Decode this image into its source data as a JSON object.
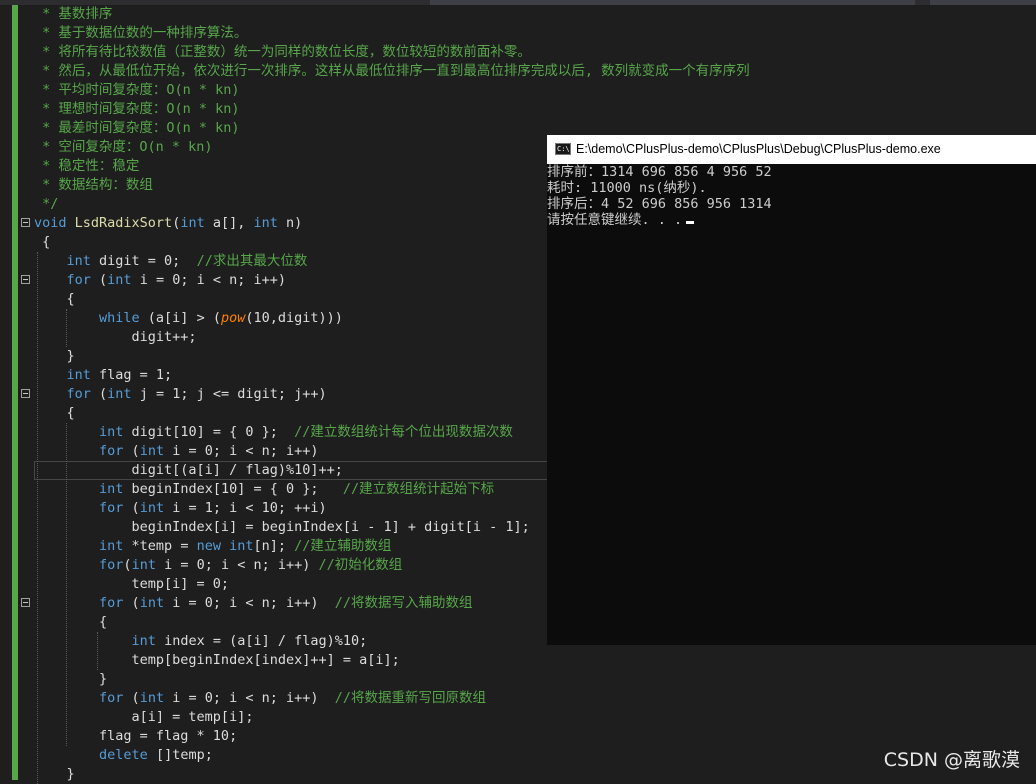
{
  "editor": {
    "lines": [
      {
        "fold": false,
        "tokens": [
          {
            "c": "cm",
            "t": " * 基数排序"
          }
        ]
      },
      {
        "fold": false,
        "tokens": [
          {
            "c": "cm",
            "t": " * 基于数据位数的一种排序算法。"
          }
        ]
      },
      {
        "fold": false,
        "tokens": [
          {
            "c": "cm",
            "t": " * 将所有待比较数值（正整数）统一为同样的数位长度，数位较短的数前面补零。"
          }
        ]
      },
      {
        "fold": false,
        "tokens": [
          {
            "c": "cm",
            "t": " * 然后，从最低位开始，依次进行一次排序。这样从最低位排序一直到最高位排序完成以后, 数列就变成一个有序序列"
          }
        ]
      },
      {
        "fold": false,
        "tokens": [
          {
            "c": "cm",
            "t": " * 平均时间复杂度：O(n * kn)"
          }
        ]
      },
      {
        "fold": false,
        "tokens": [
          {
            "c": "cm",
            "t": " * 理想时间复杂度：O(n * kn)"
          }
        ]
      },
      {
        "fold": false,
        "tokens": [
          {
            "c": "cm",
            "t": " * 最差时间复杂度：O(n * kn)"
          }
        ]
      },
      {
        "fold": false,
        "tokens": [
          {
            "c": "cm",
            "t": " * 空间复杂度：O(n * kn)"
          }
        ]
      },
      {
        "fold": false,
        "tokens": [
          {
            "c": "cm",
            "t": " * 稳定性：稳定"
          }
        ]
      },
      {
        "fold": false,
        "tokens": [
          {
            "c": "cm",
            "t": " * 数据结构：数组"
          }
        ]
      },
      {
        "fold": false,
        "tokens": [
          {
            "c": "cm",
            "t": " */"
          }
        ]
      },
      {
        "fold": true,
        "tokens": [
          {
            "c": "kw",
            "t": "void"
          },
          {
            "c": "pl",
            "t": " "
          },
          {
            "c": "fn",
            "t": "LsdRadixSort"
          },
          {
            "c": "pl",
            "t": "("
          },
          {
            "c": "kw",
            "t": "int"
          },
          {
            "c": "pl",
            "t": " a[], "
          },
          {
            "c": "kw",
            "t": "int"
          },
          {
            "c": "pl",
            "t": " n)"
          }
        ]
      },
      {
        "fold": false,
        "tokens": [
          {
            "c": "pl",
            "t": " {"
          }
        ]
      },
      {
        "fold": false,
        "tokens": [
          {
            "c": "pl",
            "t": "    "
          },
          {
            "c": "kw",
            "t": "int"
          },
          {
            "c": "pl",
            "t": " digit = 0;  "
          },
          {
            "c": "cm",
            "t": "//求出其最大位数"
          }
        ]
      },
      {
        "fold": true,
        "tokens": [
          {
            "c": "pl",
            "t": "    "
          },
          {
            "c": "kw",
            "t": "for"
          },
          {
            "c": "pl",
            "t": " ("
          },
          {
            "c": "kw",
            "t": "int"
          },
          {
            "c": "pl",
            "t": " i = 0; i < n; i++)"
          }
        ]
      },
      {
        "fold": false,
        "tokens": [
          {
            "c": "pl",
            "t": "    {"
          }
        ]
      },
      {
        "fold": false,
        "tokens": [
          {
            "c": "pl",
            "t": "        "
          },
          {
            "c": "kw",
            "t": "while"
          },
          {
            "c": "pl",
            "t": " (a[i] > ("
          },
          {
            "c": "fn2",
            "t": "pow"
          },
          {
            "c": "pl",
            "t": "(10,digit)))"
          }
        ]
      },
      {
        "fold": false,
        "tokens": [
          {
            "c": "pl",
            "t": "            digit++;"
          }
        ]
      },
      {
        "fold": false,
        "tokens": [
          {
            "c": "pl",
            "t": "    }"
          }
        ]
      },
      {
        "fold": false,
        "tokens": [
          {
            "c": "pl",
            "t": "    "
          },
          {
            "c": "kw",
            "t": "int"
          },
          {
            "c": "pl",
            "t": " flag = 1;"
          }
        ]
      },
      {
        "fold": true,
        "tokens": [
          {
            "c": "pl",
            "t": "    "
          },
          {
            "c": "kw",
            "t": "for"
          },
          {
            "c": "pl",
            "t": " ("
          },
          {
            "c": "kw",
            "t": "int"
          },
          {
            "c": "pl",
            "t": " j = 1; j <= digit; j++)"
          }
        ]
      },
      {
        "fold": false,
        "tokens": [
          {
            "c": "pl",
            "t": "    {"
          }
        ]
      },
      {
        "fold": false,
        "tokens": [
          {
            "c": "pl",
            "t": "        "
          },
          {
            "c": "kw",
            "t": "int"
          },
          {
            "c": "pl",
            "t": " digit[10] = { 0 };  "
          },
          {
            "c": "cm",
            "t": "//建立数组统计每个位出现数据次数"
          }
        ]
      },
      {
        "fold": false,
        "tokens": [
          {
            "c": "pl",
            "t": "        "
          },
          {
            "c": "kw",
            "t": "for"
          },
          {
            "c": "pl",
            "t": " ("
          },
          {
            "c": "kw",
            "t": "int"
          },
          {
            "c": "pl",
            "t": " i = 0; i < n; i++)"
          }
        ]
      },
      {
        "fold": false,
        "tokens": [
          {
            "c": "pl",
            "t": "            digit[(a[i] / flag)%10]++;"
          }
        ]
      },
      {
        "fold": false,
        "tokens": [
          {
            "c": "pl",
            "t": "        "
          },
          {
            "c": "kw",
            "t": "int"
          },
          {
            "c": "pl",
            "t": " beginIndex[10] = { 0 };   "
          },
          {
            "c": "cm",
            "t": "//建立数组统计起始下标"
          }
        ]
      },
      {
        "fold": false,
        "tokens": [
          {
            "c": "pl",
            "t": "        "
          },
          {
            "c": "kw",
            "t": "for"
          },
          {
            "c": "pl",
            "t": " ("
          },
          {
            "c": "kw",
            "t": "int"
          },
          {
            "c": "pl",
            "t": " i = 1; i < 10; ++i)"
          }
        ]
      },
      {
        "fold": false,
        "tokens": [
          {
            "c": "pl",
            "t": "            beginIndex[i] = beginIndex[i - 1] + digit[i - 1];"
          }
        ]
      },
      {
        "fold": false,
        "tokens": [
          {
            "c": "pl",
            "t": "        "
          },
          {
            "c": "kw",
            "t": "int"
          },
          {
            "c": "pl",
            "t": " *temp = "
          },
          {
            "c": "kw",
            "t": "new"
          },
          {
            "c": "pl",
            "t": " "
          },
          {
            "c": "kw",
            "t": "int"
          },
          {
            "c": "pl",
            "t": "[n]; "
          },
          {
            "c": "cm",
            "t": "//建立辅助数组"
          }
        ]
      },
      {
        "fold": false,
        "tokens": [
          {
            "c": "pl",
            "t": "        "
          },
          {
            "c": "kw",
            "t": "for"
          },
          {
            "c": "pl",
            "t": "("
          },
          {
            "c": "kw",
            "t": "int"
          },
          {
            "c": "pl",
            "t": " i = 0; i < n; i++) "
          },
          {
            "c": "cm",
            "t": "//初始化数组"
          }
        ]
      },
      {
        "fold": false,
        "tokens": [
          {
            "c": "pl",
            "t": "            temp[i] = 0;"
          }
        ]
      },
      {
        "fold": true,
        "tokens": [
          {
            "c": "pl",
            "t": "        "
          },
          {
            "c": "kw",
            "t": "for"
          },
          {
            "c": "pl",
            "t": " ("
          },
          {
            "c": "kw",
            "t": "int"
          },
          {
            "c": "pl",
            "t": " i = 0; i < n; i++)  "
          },
          {
            "c": "cm",
            "t": "//将数据写入辅助数组"
          }
        ]
      },
      {
        "fold": false,
        "tokens": [
          {
            "c": "pl",
            "t": "        {"
          }
        ]
      },
      {
        "fold": false,
        "tokens": [
          {
            "c": "pl",
            "t": "            "
          },
          {
            "c": "kw",
            "t": "int"
          },
          {
            "c": "pl",
            "t": " index = (a[i] / flag)%10;"
          }
        ]
      },
      {
        "fold": false,
        "tokens": [
          {
            "c": "pl",
            "t": "            temp[beginIndex[index]++] = a[i];"
          }
        ]
      },
      {
        "fold": false,
        "tokens": [
          {
            "c": "pl",
            "t": "        }"
          }
        ]
      },
      {
        "fold": false,
        "tokens": [
          {
            "c": "pl",
            "t": "        "
          },
          {
            "c": "kw",
            "t": "for"
          },
          {
            "c": "pl",
            "t": " ("
          },
          {
            "c": "kw",
            "t": "int"
          },
          {
            "c": "pl",
            "t": " i = 0; i < n; i++)  "
          },
          {
            "c": "cm",
            "t": "//将数据重新写回原数组"
          }
        ]
      },
      {
        "fold": false,
        "tokens": [
          {
            "c": "pl",
            "t": "            a[i] = temp[i];"
          }
        ]
      },
      {
        "fold": false,
        "tokens": [
          {
            "c": "pl",
            "t": "        flag = flag * 10;"
          }
        ]
      },
      {
        "fold": false,
        "tokens": [
          {
            "c": "pl",
            "t": "        "
          },
          {
            "c": "kw",
            "t": "delete"
          },
          {
            "c": "pl",
            "t": " []temp;"
          }
        ]
      },
      {
        "fold": false,
        "tokens": [
          {
            "c": "pl",
            "t": "    }"
          }
        ]
      }
    ]
  },
  "console": {
    "title": "E:\\demo\\CPlusPlus-demo\\CPlusPlus\\Debug\\CPlusPlus-demo.exe",
    "lines": [
      "排序前：1314 696 856 4 956 52",
      "耗时: 11000 ns(纳秒).",
      "排序后：4 52 696 856 956 1314",
      "请按任意键继续. . ."
    ]
  },
  "watermark": "CSDN @离歌漠"
}
